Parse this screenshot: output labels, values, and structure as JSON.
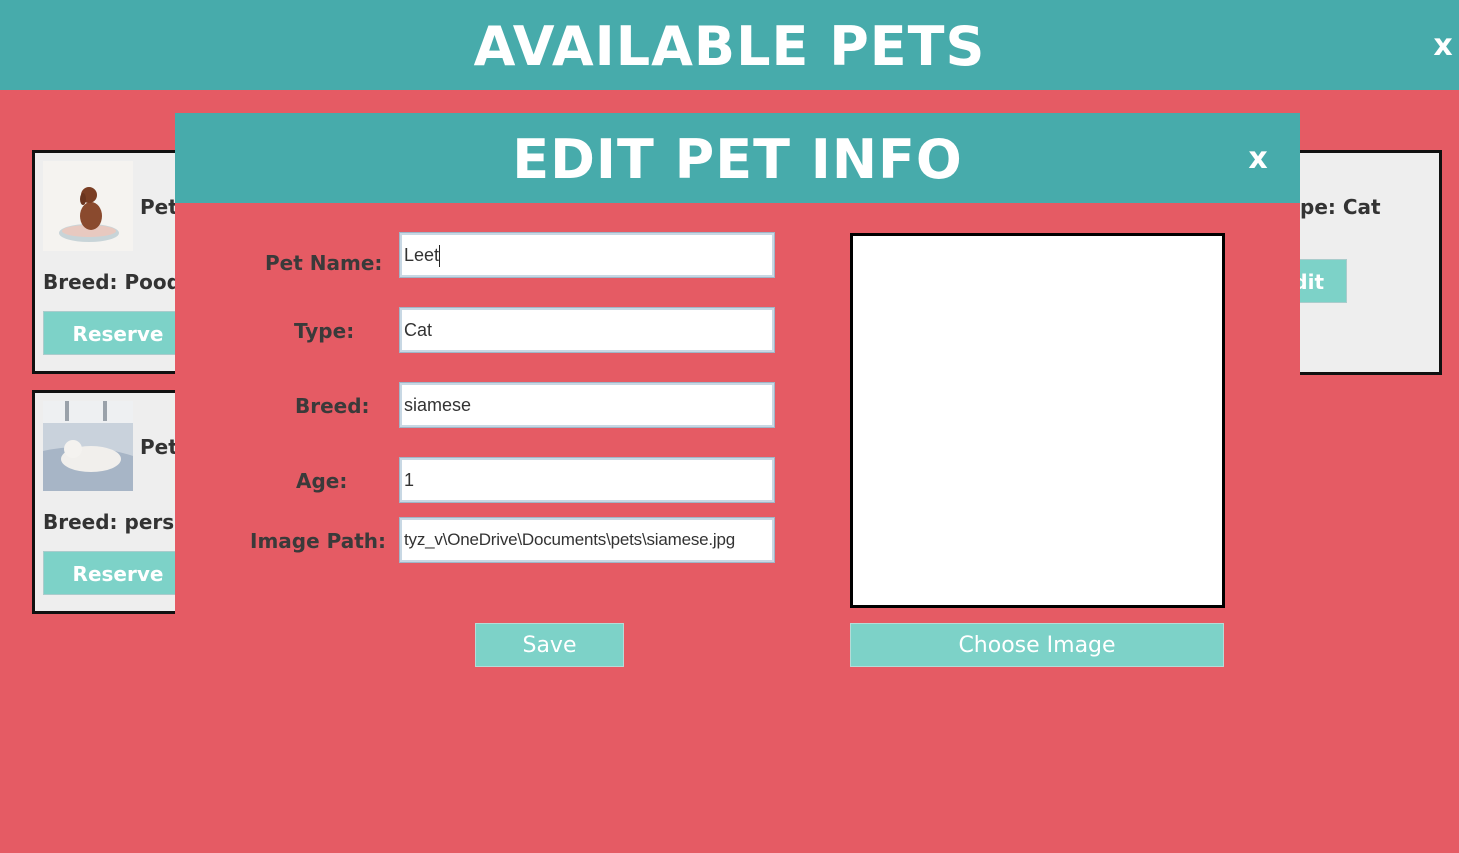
{
  "window": {
    "title": "AVAILABLE PETS",
    "close_label": "x"
  },
  "cards": [
    {
      "name_fragment": "Pet",
      "breed_fragment": "Breed: Pood",
      "reserve_label": "Reserve"
    },
    {
      "name_fragment": "Pet",
      "breed_fragment": "Breed: persi",
      "reserve_label": "Reserve"
    },
    {
      "type_fragment": "pe: Cat",
      "edit_fragment": "dit"
    }
  ],
  "modal": {
    "title": "EDIT PET INFO",
    "close_label": "x",
    "fields": {
      "pet_name": {
        "label": "Pet Name:",
        "value": "Leet"
      },
      "type": {
        "label": "Type:",
        "value": "Cat"
      },
      "breed": {
        "label": "Breed:",
        "value": "siamese"
      },
      "age": {
        "label": "Age:",
        "value": "1"
      },
      "image_path": {
        "label": "Image Path:",
        "value": "tyz_v\\OneDrive\\Documents\\pets\\siamese.jpg"
      }
    },
    "save_label": "Save",
    "choose_image_label": "Choose Image"
  },
  "colors": {
    "background": "#e55b64",
    "header": "#47abab",
    "button": "#7dd2c8",
    "card": "#eeeeee"
  }
}
